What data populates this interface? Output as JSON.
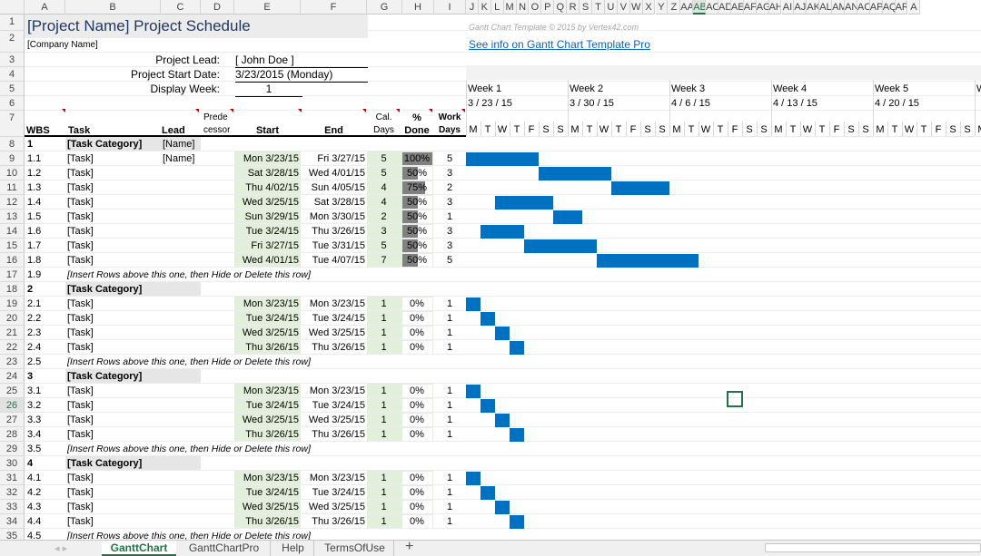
{
  "columns": [
    "A",
    "B",
    "C",
    "D",
    "E",
    "F",
    "G",
    "H",
    "I",
    "J",
    "K",
    "L",
    "M",
    "N",
    "O",
    "P",
    "Q",
    "R",
    "S",
    "T",
    "U",
    "V",
    "W",
    "X",
    "Y",
    "Z",
    "AA",
    "AB",
    "AC",
    "AD",
    "AE",
    "AF",
    "AG",
    "AH",
    "AI",
    "AJ",
    "AK",
    "AL",
    "AM",
    "AN",
    "AC",
    "AP",
    "AQ",
    "AR",
    "A"
  ],
  "selected_column": "AB",
  "selected_row": "26",
  "title": "[Project Name] Project Schedule",
  "company": "[Company Name]",
  "copyright": "Gantt Chart Template © 2015 by Vertex42.com",
  "info_link": "See info on Gantt Chart Template Pro",
  "labels": {
    "lead": "Project Lead:",
    "start": "Project Start Date:",
    "week": "Display Week:"
  },
  "values": {
    "lead": "[ John Doe ]",
    "start": "3/23/2015 (Monday)",
    "week": "1"
  },
  "weeks": [
    {
      "label": "Week 1",
      "date": "3 / 23 / 15"
    },
    {
      "label": "Week 2",
      "date": "3 / 30 / 15"
    },
    {
      "label": "Week 3",
      "date": "4 / 6 / 15"
    },
    {
      "label": "Week 4",
      "date": "4 / 13 / 15"
    },
    {
      "label": "Week 5",
      "date": "4 / 20 / 15"
    },
    {
      "label": "W",
      "date": ""
    }
  ],
  "day_letters": [
    "M",
    "T",
    "W",
    "T",
    "F",
    "S",
    "S",
    "M",
    "T",
    "W",
    "T",
    "F",
    "S",
    "S",
    "M",
    "T",
    "W",
    "T",
    "F",
    "S",
    "S",
    "M",
    "T",
    "W",
    "T",
    "F",
    "S",
    "S",
    "M",
    "T",
    "W",
    "T",
    "F",
    "S",
    "S",
    "M"
  ],
  "headers": {
    "wbs": "WBS",
    "task": "Task",
    "lead": "Lead",
    "pred1": "Prede",
    "pred2": "cessor",
    "start": "Start",
    "end": "End",
    "cal1": "Cal.",
    "cal2": "Days",
    "pct1": "%",
    "pct2": "Done",
    "work1": "Work",
    "work2": "Days"
  },
  "rows": [
    {
      "n": "8",
      "kind": "cat",
      "wbs": "1",
      "task": "[Task Category]",
      "lead": "[Name]"
    },
    {
      "n": "9",
      "kind": "task",
      "wbs": "1.1",
      "task": "[Task]",
      "lead": "[Name]",
      "start": "Mon 3/23/15",
      "end": "Fri 3/27/15",
      "cal": "5",
      "pct": "100%",
      "pct_value": 100,
      "work": "5",
      "bar_start": 0,
      "bar_days": 5
    },
    {
      "n": "10",
      "kind": "task",
      "wbs": "1.2",
      "task": "[Task]",
      "lead": "",
      "start": "Sat 3/28/15",
      "end": "Wed 4/01/15",
      "cal": "5",
      "pct": "50%",
      "pct_value": 50,
      "work": "3",
      "bar_start": 5,
      "bar_days": 5
    },
    {
      "n": "11",
      "kind": "task",
      "wbs": "1.3",
      "task": "[Task]",
      "lead": "",
      "start": "Thu 4/02/15",
      "end": "Sun 4/05/15",
      "cal": "4",
      "pct": "75%",
      "pct_value": 75,
      "work": "2",
      "bar_start": 10,
      "bar_days": 4
    },
    {
      "n": "12",
      "kind": "task",
      "wbs": "1.4",
      "task": "[Task]",
      "lead": "",
      "start": "Wed 3/25/15",
      "end": "Sat 3/28/15",
      "cal": "4",
      "pct": "50%",
      "pct_value": 50,
      "work": "3",
      "bar_start": 2,
      "bar_days": 4
    },
    {
      "n": "13",
      "kind": "task",
      "wbs": "1.5",
      "task": "[Task]",
      "lead": "",
      "start": "Sun 3/29/15",
      "end": "Mon 3/30/15",
      "cal": "2",
      "pct": "50%",
      "pct_value": 50,
      "work": "1",
      "bar_start": 6,
      "bar_days": 2
    },
    {
      "n": "14",
      "kind": "task",
      "wbs": "1.6",
      "task": "[Task]",
      "lead": "",
      "start": "Tue 3/24/15",
      "end": "Thu 3/26/15",
      "cal": "3",
      "pct": "50%",
      "pct_value": 50,
      "work": "3",
      "bar_start": 1,
      "bar_days": 3
    },
    {
      "n": "15",
      "kind": "task",
      "wbs": "1.7",
      "task": "[Task]",
      "lead": "",
      "start": "Fri 3/27/15",
      "end": "Tue 3/31/15",
      "cal": "5",
      "pct": "50%",
      "pct_value": 50,
      "work": "3",
      "bar_start": 4,
      "bar_days": 5
    },
    {
      "n": "16",
      "kind": "task",
      "wbs": "1.8",
      "task": "[Task]",
      "lead": "",
      "start": "Wed 4/01/15",
      "end": "Tue 4/07/15",
      "cal": "7",
      "pct": "50%",
      "pct_value": 50,
      "work": "5",
      "bar_start": 9,
      "bar_days": 7
    },
    {
      "n": "17",
      "kind": "insert",
      "wbs": "1.9",
      "task": "[Insert Rows above this one, then Hide or Delete this row]"
    },
    {
      "n": "18",
      "kind": "cat",
      "wbs": "2",
      "task": "[Task Category]",
      "lead": ""
    },
    {
      "n": "19",
      "kind": "task",
      "wbs": "2.1",
      "task": "[Task]",
      "lead": "",
      "start": "Mon 3/23/15",
      "end": "Mon 3/23/15",
      "cal": "1",
      "pct": "0%",
      "pct_value": 0,
      "work": "1",
      "bar_start": 0,
      "bar_days": 1
    },
    {
      "n": "20",
      "kind": "task",
      "wbs": "2.2",
      "task": "[Task]",
      "lead": "",
      "start": "Tue 3/24/15",
      "end": "Tue 3/24/15",
      "cal": "1",
      "pct": "0%",
      "pct_value": 0,
      "work": "1",
      "bar_start": 1,
      "bar_days": 1
    },
    {
      "n": "21",
      "kind": "task",
      "wbs": "2.3",
      "task": "[Task]",
      "lead": "",
      "start": "Wed 3/25/15",
      "end": "Wed 3/25/15",
      "cal": "1",
      "pct": "0%",
      "pct_value": 0,
      "work": "1",
      "bar_start": 2,
      "bar_days": 1
    },
    {
      "n": "22",
      "kind": "task",
      "wbs": "2.4",
      "task": "[Task]",
      "lead": "",
      "start": "Thu 3/26/15",
      "end": "Thu 3/26/15",
      "cal": "1",
      "pct": "0%",
      "pct_value": 0,
      "work": "1",
      "bar_start": 3,
      "bar_days": 1
    },
    {
      "n": "23",
      "kind": "insert",
      "wbs": "2.5",
      "task": "[Insert Rows above this one, then Hide or Delete this row]"
    },
    {
      "n": "24",
      "kind": "cat",
      "wbs": "3",
      "task": "[Task Category]",
      "lead": ""
    },
    {
      "n": "25",
      "kind": "task",
      "wbs": "3.1",
      "task": "[Task]",
      "lead": "",
      "start": "Mon 3/23/15",
      "end": "Mon 3/23/15",
      "cal": "1",
      "pct": "0%",
      "pct_value": 0,
      "work": "1",
      "bar_start": 0,
      "bar_days": 1
    },
    {
      "n": "26",
      "kind": "task",
      "wbs": "3.2",
      "task": "[Task]",
      "lead": "",
      "start": "Tue 3/24/15",
      "end": "Tue 3/24/15",
      "cal": "1",
      "pct": "0%",
      "pct_value": 0,
      "work": "1",
      "bar_start": 1,
      "bar_days": 1
    },
    {
      "n": "27",
      "kind": "task",
      "wbs": "3.3",
      "task": "[Task]",
      "lead": "",
      "start": "Wed 3/25/15",
      "end": "Wed 3/25/15",
      "cal": "1",
      "pct": "0%",
      "pct_value": 0,
      "work": "1",
      "bar_start": 2,
      "bar_days": 1
    },
    {
      "n": "28",
      "kind": "task",
      "wbs": "3.4",
      "task": "[Task]",
      "lead": "",
      "start": "Thu 3/26/15",
      "end": "Thu 3/26/15",
      "cal": "1",
      "pct": "0%",
      "pct_value": 0,
      "work": "1",
      "bar_start": 3,
      "bar_days": 1
    },
    {
      "n": "29",
      "kind": "insert",
      "wbs": "3.5",
      "task": "[Insert Rows above this one, then Hide or Delete this row]"
    },
    {
      "n": "30",
      "kind": "cat",
      "wbs": "4",
      "task": "[Task Category]",
      "lead": ""
    },
    {
      "n": "31",
      "kind": "task",
      "wbs": "4.1",
      "task": "[Task]",
      "lead": "",
      "start": "Mon 3/23/15",
      "end": "Mon 3/23/15",
      "cal": "1",
      "pct": "0%",
      "pct_value": 0,
      "work": "1",
      "bar_start": 0,
      "bar_days": 1
    },
    {
      "n": "32",
      "kind": "task",
      "wbs": "4.2",
      "task": "[Task]",
      "lead": "",
      "start": "Tue 3/24/15",
      "end": "Tue 3/24/15",
      "cal": "1",
      "pct": "0%",
      "pct_value": 0,
      "work": "1",
      "bar_start": 1,
      "bar_days": 1
    },
    {
      "n": "33",
      "kind": "task",
      "wbs": "4.3",
      "task": "[Task]",
      "lead": "",
      "start": "Wed 3/25/15",
      "end": "Wed 3/25/15",
      "cal": "1",
      "pct": "0%",
      "pct_value": 0,
      "work": "1",
      "bar_start": 2,
      "bar_days": 1
    },
    {
      "n": "34",
      "kind": "task",
      "wbs": "4.4",
      "task": "[Task]",
      "lead": "",
      "start": "Thu 3/26/15",
      "end": "Thu 3/26/15",
      "cal": "1",
      "pct": "0%",
      "pct_value": 0,
      "work": "1",
      "bar_start": 3,
      "bar_days": 1
    },
    {
      "n": "35",
      "kind": "insert",
      "wbs": "4.5",
      "task": "[Insert Rows above this one, then Hide or Delete this row]"
    }
  ],
  "tabs": [
    {
      "label": "GanttChart",
      "active": true
    },
    {
      "label": "GanttChartPro",
      "active": false
    },
    {
      "label": "Help",
      "active": false
    },
    {
      "label": "TermsOfUse",
      "active": false
    }
  ],
  "add_sheet": "+",
  "sheet_nav": "◂ ▸",
  "colors": {
    "bar": "#0070c0",
    "title": "#1f3864",
    "selection": "#217346",
    "task_fill": "#e2efda",
    "category_fill": "#e7e6e6"
  }
}
